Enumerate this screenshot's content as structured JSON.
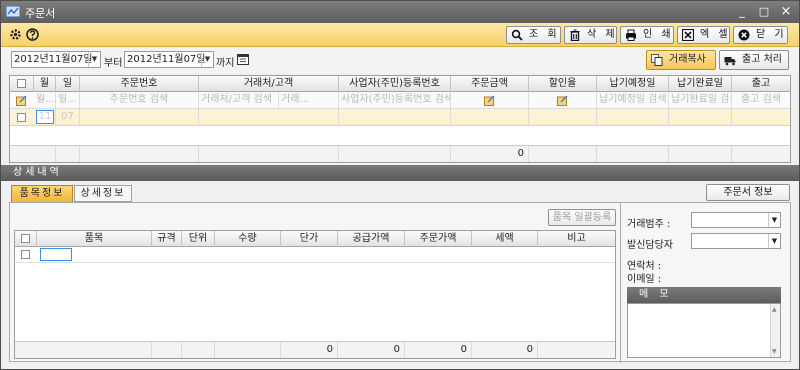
{
  "window": {
    "title": "주문서",
    "minimize": "_",
    "maximize": "□",
    "close": "×"
  },
  "toolbar": {
    "search_label": "조 회",
    "delete_label": "삭 제",
    "print_label": "인 쇄",
    "excel_label": "엑 셀",
    "close_label": "닫 기"
  },
  "filter": {
    "date_from": "2012년11월07일",
    "from_suffix": "부터",
    "date_to": "2012년11월07일",
    "to_suffix": "까지",
    "copy_label": "거래복사",
    "ship_label": "출고 처리"
  },
  "main_grid": {
    "headers": [
      "월",
      "일",
      "주문번호",
      "거래처/고객",
      "사업자(주민)등록번호",
      "주문금액",
      "할인율",
      "납기예정일",
      "납기완료일",
      "출고"
    ],
    "search_row": [
      "월...",
      "일...",
      "주문번호 검색",
      "거래처/고객 검색",
      "거래...",
      "사업자(주민)등록번호 검색",
      "",
      "",
      "납기예정일 검색",
      "납기완료일 검색",
      "출고 검색"
    ],
    "new_row": {
      "month": "11",
      "day": "07"
    },
    "total": "0"
  },
  "detail": {
    "section_title": "상세내역",
    "tab_items": "품목정보",
    "tab_detail": "상세정보",
    "order_info_label": "주문서 정보",
    "bulk_register_label": "품목 일괄등록",
    "headers": [
      "품목",
      "규격",
      "단위",
      "수량",
      "단가",
      "공급가액",
      "주문가액",
      "세액",
      "비고"
    ],
    "totals": [
      "0",
      "0",
      "0",
      "0"
    ],
    "trade_class_label": "거래범주 :",
    "manager_label": "발신담당자",
    "contact_label": "연락처 :",
    "email_label": "이메일 :",
    "memo_label": "메 모"
  }
}
